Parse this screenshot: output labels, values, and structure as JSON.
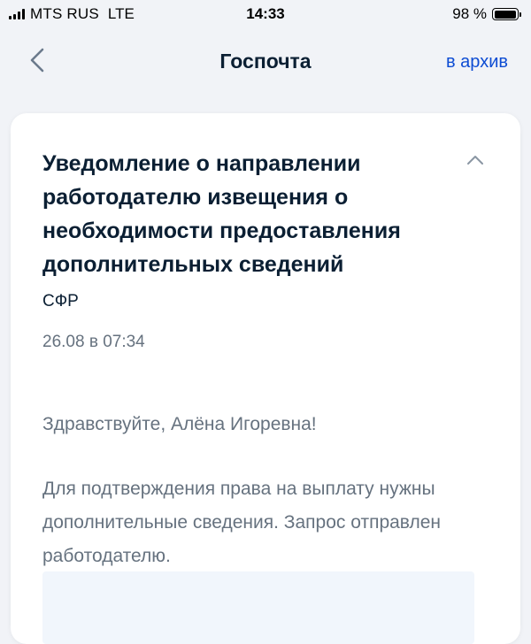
{
  "status_bar": {
    "carrier": "MTS RUS",
    "network": "LTE",
    "time": "14:33",
    "battery_percent": "98 %",
    "battery_level": 0.98
  },
  "nav": {
    "title": "Госпочта",
    "archive_label": "в архив",
    "back_icon": "chevron-left-icon"
  },
  "message": {
    "title": "Уведомление о направлении работодателю извещения о необходимости предоставления дополнительных сведений",
    "sender": "СФР",
    "date": "26.08 в 07:34",
    "greeting": "Здравствуйте, Алёна Игоревна!",
    "body": "Для подтверждения права на выплату нужны дополнительные сведения. Запрос отправлен работодателю.",
    "collapse_icon": "chevron-up-icon"
  },
  "colors": {
    "accent": "#0d4cd3",
    "text_primary": "#0b1f33",
    "text_secondary": "#66727f",
    "background": "#f1f3f7",
    "card": "#ffffff"
  }
}
